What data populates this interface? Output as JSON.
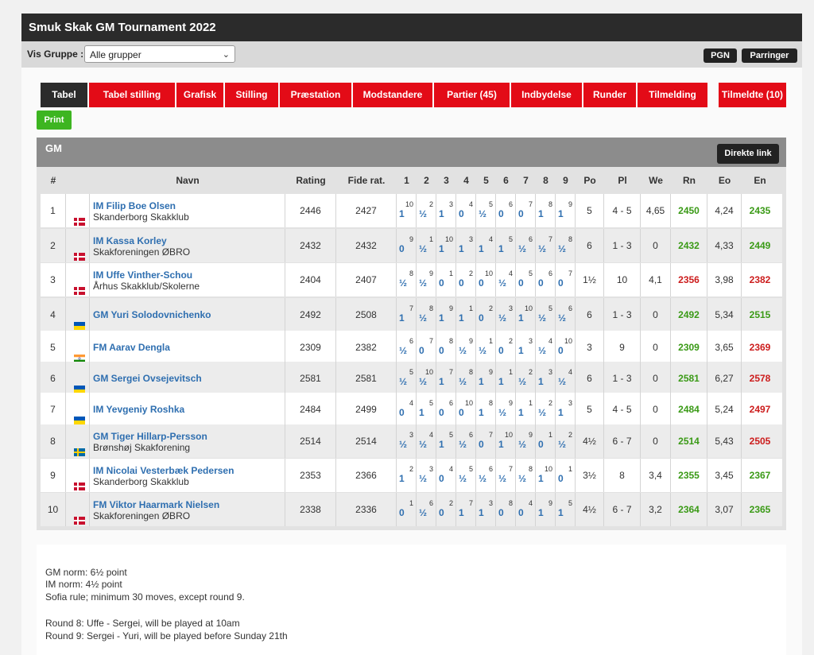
{
  "title": "Smuk Skak GM Tournament 2022",
  "filter": {
    "label": "Vis Gruppe :",
    "selected": "Alle grupper"
  },
  "buttons": {
    "pgn": "PGN",
    "parringer": "Parringer",
    "print": "Print",
    "direkte_link": "Direkte link"
  },
  "tabs": [
    "Tabel",
    "Tabel stilling",
    "Grafisk",
    "Stilling",
    "Præstation",
    "Modstandere",
    "Partier (45)",
    "Indbydelse",
    "Runder",
    "Tilmelding",
    "Tilmeldte (10)"
  ],
  "group": "GM",
  "columns": [
    "#",
    "Navn",
    "Rating",
    "Fide rat.",
    "1",
    "2",
    "3",
    "4",
    "5",
    "6",
    "7",
    "8",
    "9",
    "Po",
    "Pl",
    "We",
    "Rn",
    "Eo",
    "En"
  ],
  "players": [
    {
      "no": "1",
      "flag": "dk",
      "title_name": "IM Filip Boe Olsen",
      "club": "Skanderborg Skakklub",
      "rating": "2446",
      "fide": "2427",
      "rounds": [
        [
          "10",
          "1"
        ],
        [
          "2",
          "½"
        ],
        [
          "3",
          "1"
        ],
        [
          "4",
          "0"
        ],
        [
          "5",
          "½"
        ],
        [
          "6",
          "0"
        ],
        [
          "7",
          "0"
        ],
        [
          "8",
          "1"
        ],
        [
          "9",
          "1"
        ]
      ],
      "po": "5",
      "pl": "4 - 5",
      "we": "4,65",
      "rn": "2450",
      "rn_color": "green",
      "eo": "4,24",
      "en": "2435",
      "en_color": "green"
    },
    {
      "no": "2",
      "flag": "dk",
      "title_name": "IM Kassa Korley",
      "club": "Skakforeningen ØBRO",
      "rating": "2432",
      "fide": "2432",
      "rounds": [
        [
          "9",
          "0"
        ],
        [
          "1",
          "½"
        ],
        [
          "10",
          "1"
        ],
        [
          "3",
          "1"
        ],
        [
          "4",
          "1"
        ],
        [
          "5",
          "1"
        ],
        [
          "6",
          "½"
        ],
        [
          "7",
          "½"
        ],
        [
          "8",
          "½"
        ]
      ],
      "po": "6",
      "pl": "1 - 3",
      "we": "0",
      "rn": "2432",
      "rn_color": "green",
      "eo": "4,33",
      "en": "2449",
      "en_color": "green"
    },
    {
      "no": "3",
      "flag": "dk",
      "title_name": "IM Uffe Vinther-Schou",
      "club": "Århus Skakklub/Skolerne",
      "rating": "2404",
      "fide": "2407",
      "rounds": [
        [
          "8",
          "½"
        ],
        [
          "9",
          "½"
        ],
        [
          "1",
          "0"
        ],
        [
          "2",
          "0"
        ],
        [
          "10",
          "0"
        ],
        [
          "4",
          "½"
        ],
        [
          "5",
          "0"
        ],
        [
          "6",
          "0"
        ],
        [
          "7",
          "0"
        ]
      ],
      "po": "1½",
      "pl": "10",
      "we": "4,1",
      "rn": "2356",
      "rn_color": "red",
      "eo": "3,98",
      "en": "2382",
      "en_color": "red"
    },
    {
      "no": "4",
      "flag": "ua",
      "title_name": "GM Yuri Solodovnichenko",
      "club": "",
      "rating": "2492",
      "fide": "2508",
      "rounds": [
        [
          "7",
          "1"
        ],
        [
          "8",
          "½"
        ],
        [
          "9",
          "1"
        ],
        [
          "1",
          "1"
        ],
        [
          "2",
          "0"
        ],
        [
          "3",
          "½"
        ],
        [
          "10",
          "1"
        ],
        [
          "5",
          "½"
        ],
        [
          "6",
          "½"
        ]
      ],
      "po": "6",
      "pl": "1 - 3",
      "we": "0",
      "rn": "2492",
      "rn_color": "green",
      "eo": "5,34",
      "en": "2515",
      "en_color": "green"
    },
    {
      "no": "5",
      "flag": "in",
      "title_name": "FM Aarav Dengla",
      "club": "",
      "rating": "2309",
      "fide": "2382",
      "rounds": [
        [
          "6",
          "½"
        ],
        [
          "7",
          "0"
        ],
        [
          "8",
          "0"
        ],
        [
          "9",
          "½"
        ],
        [
          "1",
          "½"
        ],
        [
          "2",
          "0"
        ],
        [
          "3",
          "1"
        ],
        [
          "4",
          "½"
        ],
        [
          "10",
          "0"
        ]
      ],
      "po": "3",
      "pl": "9",
      "we": "0",
      "rn": "2309",
      "rn_color": "green",
      "eo": "3,65",
      "en": "2369",
      "en_color": "red"
    },
    {
      "no": "6",
      "flag": "ua",
      "title_name": "GM Sergei Ovsejevitsch",
      "club": "",
      "rating": "2581",
      "fide": "2581",
      "rounds": [
        [
          "5",
          "½"
        ],
        [
          "10",
          "½"
        ],
        [
          "7",
          "1"
        ],
        [
          "8",
          "½"
        ],
        [
          "9",
          "1"
        ],
        [
          "1",
          "1"
        ],
        [
          "2",
          "½"
        ],
        [
          "3",
          "1"
        ],
        [
          "4",
          "½"
        ]
      ],
      "po": "6",
      "pl": "1 - 3",
      "we": "0",
      "rn": "2581",
      "rn_color": "green",
      "eo": "6,27",
      "en": "2578",
      "en_color": "red"
    },
    {
      "no": "7",
      "flag": "ua",
      "title_name": "IM Yevgeniy Roshka",
      "club": "",
      "rating": "2484",
      "fide": "2499",
      "rounds": [
        [
          "4",
          "0"
        ],
        [
          "5",
          "1"
        ],
        [
          "6",
          "0"
        ],
        [
          "10",
          "0"
        ],
        [
          "8",
          "1"
        ],
        [
          "9",
          "½"
        ],
        [
          "1",
          "1"
        ],
        [
          "2",
          "½"
        ],
        [
          "3",
          "1"
        ]
      ],
      "po": "5",
      "pl": "4 - 5",
      "we": "0",
      "rn": "2484",
      "rn_color": "green",
      "eo": "5,24",
      "en": "2497",
      "en_color": "red"
    },
    {
      "no": "8",
      "flag": "se",
      "title_name": "GM Tiger Hillarp-Persson",
      "club": "Brønshøj Skakforening",
      "rating": "2514",
      "fide": "2514",
      "rounds": [
        [
          "3",
          "½"
        ],
        [
          "4",
          "½"
        ],
        [
          "5",
          "1"
        ],
        [
          "6",
          "½"
        ],
        [
          "7",
          "0"
        ],
        [
          "10",
          "1"
        ],
        [
          "9",
          "½"
        ],
        [
          "1",
          "0"
        ],
        [
          "2",
          "½"
        ]
      ],
      "po": "4½",
      "pl": "6 - 7",
      "we": "0",
      "rn": "2514",
      "rn_color": "green",
      "eo": "5,43",
      "en": "2505",
      "en_color": "red"
    },
    {
      "no": "9",
      "flag": "dk",
      "title_name": "IM Nicolai Vesterbæk Pedersen",
      "club": "Skanderborg Skakklub",
      "rating": "2353",
      "fide": "2366",
      "rounds": [
        [
          "2",
          "1"
        ],
        [
          "3",
          "½"
        ],
        [
          "4",
          "0"
        ],
        [
          "5",
          "½"
        ],
        [
          "6",
          "½"
        ],
        [
          "7",
          "½"
        ],
        [
          "8",
          "½"
        ],
        [
          "10",
          "1"
        ],
        [
          "1",
          "0"
        ]
      ],
      "po": "3½",
      "pl": "8",
      "we": "3,4",
      "rn": "2355",
      "rn_color": "green",
      "eo": "3,45",
      "en": "2367",
      "en_color": "green"
    },
    {
      "no": "10",
      "flag": "dk",
      "title_name": "FM Viktor Haarmark Nielsen",
      "club": "Skakforeningen ØBRO",
      "rating": "2338",
      "fide": "2336",
      "rounds": [
        [
          "1",
          "0"
        ],
        [
          "6",
          "½"
        ],
        [
          "2",
          "0"
        ],
        [
          "7",
          "1"
        ],
        [
          "3",
          "1"
        ],
        [
          "8",
          "0"
        ],
        [
          "4",
          "0"
        ],
        [
          "9",
          "1"
        ],
        [
          "5",
          "1"
        ]
      ],
      "po": "4½",
      "pl": "6 - 7",
      "we": "3,2",
      "rn": "2364",
      "rn_color": "green",
      "eo": "3,07",
      "en": "2365",
      "en_color": "green"
    }
  ],
  "notes": [
    "GM norm: 6½ point",
    "IM norm: 4½ point",
    "Sofia rule; minimum 30 moves, except round 9.",
    "Round 8: Uffe - Sergei, will be played at 10am",
    "Round 9: Sergei - Yuri, will be played before Sunday 21th"
  ],
  "colors": {
    "accent_red": "#e30b17",
    "green_text": "#3a9a16",
    "red_text": "#cc1c1c",
    "link_blue": "#2f6fb0"
  }
}
